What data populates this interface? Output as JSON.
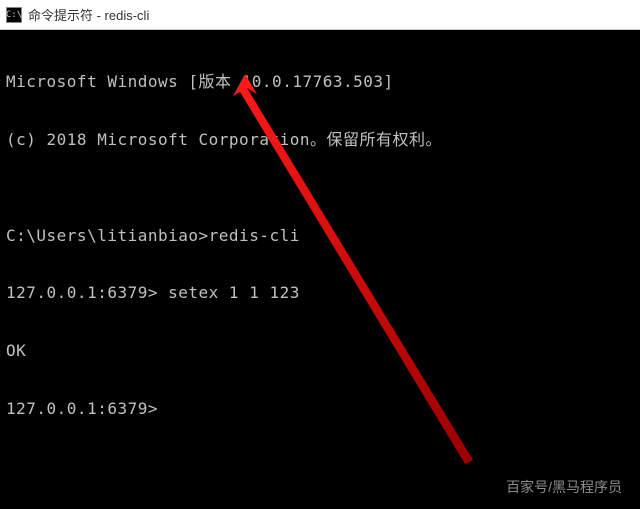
{
  "window": {
    "icon_label": "C:\\",
    "title": "命令提示符 - redis-cli"
  },
  "terminal": {
    "lines": [
      "Microsoft Windows [版本 10.0.17763.503]",
      "(c) 2018 Microsoft Corporation。保留所有权利。",
      "",
      "C:\\Users\\litianbiao>redis-cli",
      "127.0.0.1:6379> setex 1 1 123",
      "OK",
      "127.0.0.1:6379>"
    ]
  },
  "annotation": {
    "arrow_color": "#e60000"
  },
  "watermark": {
    "text": "百家号/黑马程序员"
  }
}
